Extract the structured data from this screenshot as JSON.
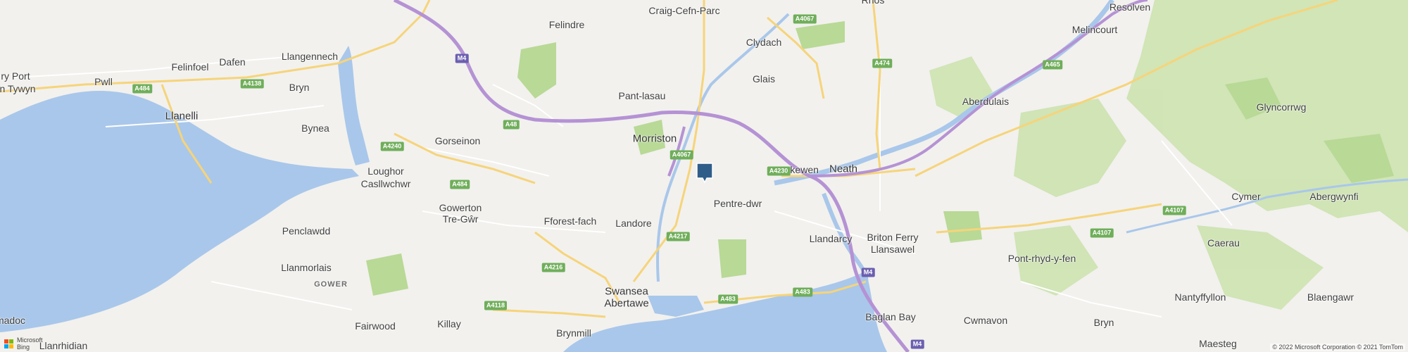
{
  "colors": {
    "land": "#f2f1ee",
    "water": "#a9c7ea",
    "forest": "#cde3b0",
    "park": "#b9d996",
    "motorway": "#b592d4",
    "primary_road": "#f6d47a",
    "minor_road": "#ffffff",
    "marker": "#2f5d8a",
    "shield_green": "#6fae5a",
    "shield_motorway": "#6b5fb0"
  },
  "places": [
    {
      "name": "Craig-Cefn-Parc"
    },
    {
      "name": "Rhos"
    },
    {
      "name": "Resolven"
    },
    {
      "name": "Felindre"
    },
    {
      "name": "Clydach"
    },
    {
      "name": "Melincourt"
    },
    {
      "name": "Felinfoel"
    },
    {
      "name": "ry Port"
    },
    {
      "name": "n Tywyn"
    },
    {
      "name": "Dafen"
    },
    {
      "name": "Llangennech"
    },
    {
      "name": "Pwll"
    },
    {
      "name": "Bryn"
    },
    {
      "name": "Glais"
    },
    {
      "name": "Pant-lasau"
    },
    {
      "name": "Aberdulais"
    },
    {
      "name": "Llanelli"
    },
    {
      "name": "Glyncorrwg"
    },
    {
      "name": "Bynea"
    },
    {
      "name": "Gorseinon"
    },
    {
      "name": "Morriston"
    },
    {
      "name": "Skewen"
    },
    {
      "name": "Neath"
    },
    {
      "name": "Loughor"
    },
    {
      "name": "Casllwchwr"
    },
    {
      "name": "Cymer"
    },
    {
      "name": "Abergwynfi"
    },
    {
      "name": "Gowerton"
    },
    {
      "name": "Tre-Gŵr"
    },
    {
      "name": "Pentre-dwr"
    },
    {
      "name": "Fforest-fach"
    },
    {
      "name": "Landore"
    },
    {
      "name": "Llandarcy"
    },
    {
      "name": "Briton Ferry"
    },
    {
      "name": "Llansawel"
    },
    {
      "name": "Caerau"
    },
    {
      "name": "Penclawdd"
    },
    {
      "name": "Pont-rhyd-y-fen"
    },
    {
      "name": "Llanmorlais"
    },
    {
      "name": "Swansea"
    },
    {
      "name": "Abertawe"
    },
    {
      "name": "Nantyffyllon"
    },
    {
      "name": "Blaengawr"
    },
    {
      "name": "Fairwood"
    },
    {
      "name": "Killay"
    },
    {
      "name": "Baglan Bay"
    },
    {
      "name": "Cwmavon"
    },
    {
      "name": "Bryn"
    },
    {
      "name": "madoc"
    },
    {
      "name": "Llanrhidian"
    },
    {
      "name": "Brynmill"
    },
    {
      "name": "Maesteg"
    }
  ],
  "region_label": "GOWER",
  "road_shields": [
    {
      "ref": "A4067",
      "kind": "green"
    },
    {
      "ref": "M4",
      "kind": "moto"
    },
    {
      "ref": "A474",
      "kind": "green"
    },
    {
      "ref": "A465",
      "kind": "green"
    },
    {
      "ref": "A484",
      "kind": "green"
    },
    {
      "ref": "A4138",
      "kind": "green"
    },
    {
      "ref": "A48",
      "kind": "green"
    },
    {
      "ref": "A4240",
      "kind": "green"
    },
    {
      "ref": "A4067",
      "kind": "green"
    },
    {
      "ref": "A4230",
      "kind": "green"
    },
    {
      "ref": "A484",
      "kind": "green"
    },
    {
      "ref": "A4107",
      "kind": "green"
    },
    {
      "ref": "A4107",
      "kind": "green"
    },
    {
      "ref": "A4217",
      "kind": "green"
    },
    {
      "ref": "A4216",
      "kind": "green"
    },
    {
      "ref": "A483",
      "kind": "green"
    },
    {
      "ref": "A483",
      "kind": "green"
    },
    {
      "ref": "M4",
      "kind": "moto"
    },
    {
      "ref": "A4118",
      "kind": "green"
    },
    {
      "ref": "M4",
      "kind": "moto"
    }
  ],
  "marker": {
    "icon": "map-pin-icon"
  },
  "branding": {
    "line1": "Microsoft",
    "line2": "Bing"
  },
  "copyright": "© 2022 Microsoft Corporation © 2021 TomTom"
}
